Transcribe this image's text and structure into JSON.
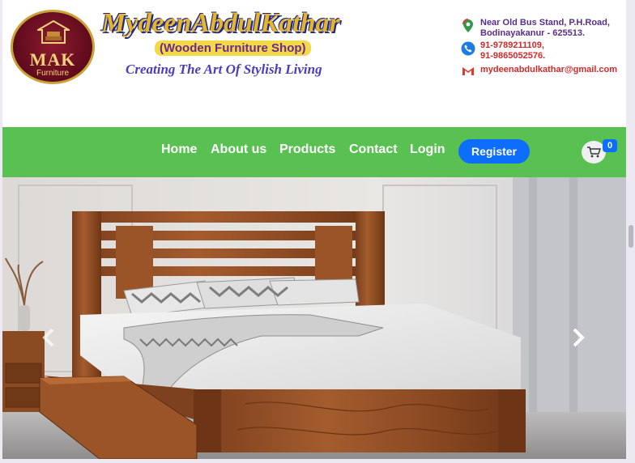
{
  "header": {
    "logo_text": "MAK",
    "logo_sub": "Furniture",
    "brand_name": "MydeenAbdulKathar",
    "subtitle": "(Wooden Furniture Shop)",
    "tagline": "Creating The Art Of Stylish Living",
    "contact": {
      "address_line1": "Near Old Bus Stand, P.H.Road,",
      "address_line2": "Bodinayakanur - 625513.",
      "phone1": "91-9789211109,",
      "phone2": "91-9865052576.",
      "email": "mydeenabdulkathar@gmail.com"
    }
  },
  "nav": {
    "items": [
      {
        "label": "Home"
      },
      {
        "label": "About us"
      },
      {
        "label": "Products"
      },
      {
        "label": "Contact"
      },
      {
        "label": "Login"
      }
    ],
    "register_label": "Register",
    "cart_count": "0"
  },
  "hero": {
    "prev_icon": "chevron-left-icon",
    "next_icon": "chevron-right-icon"
  },
  "colors": {
    "nav_bg": "#59c152",
    "register_bg": "#0d6efd",
    "brand_gold": "#e8b52a",
    "tagline_blue": "#4b3bbd"
  }
}
